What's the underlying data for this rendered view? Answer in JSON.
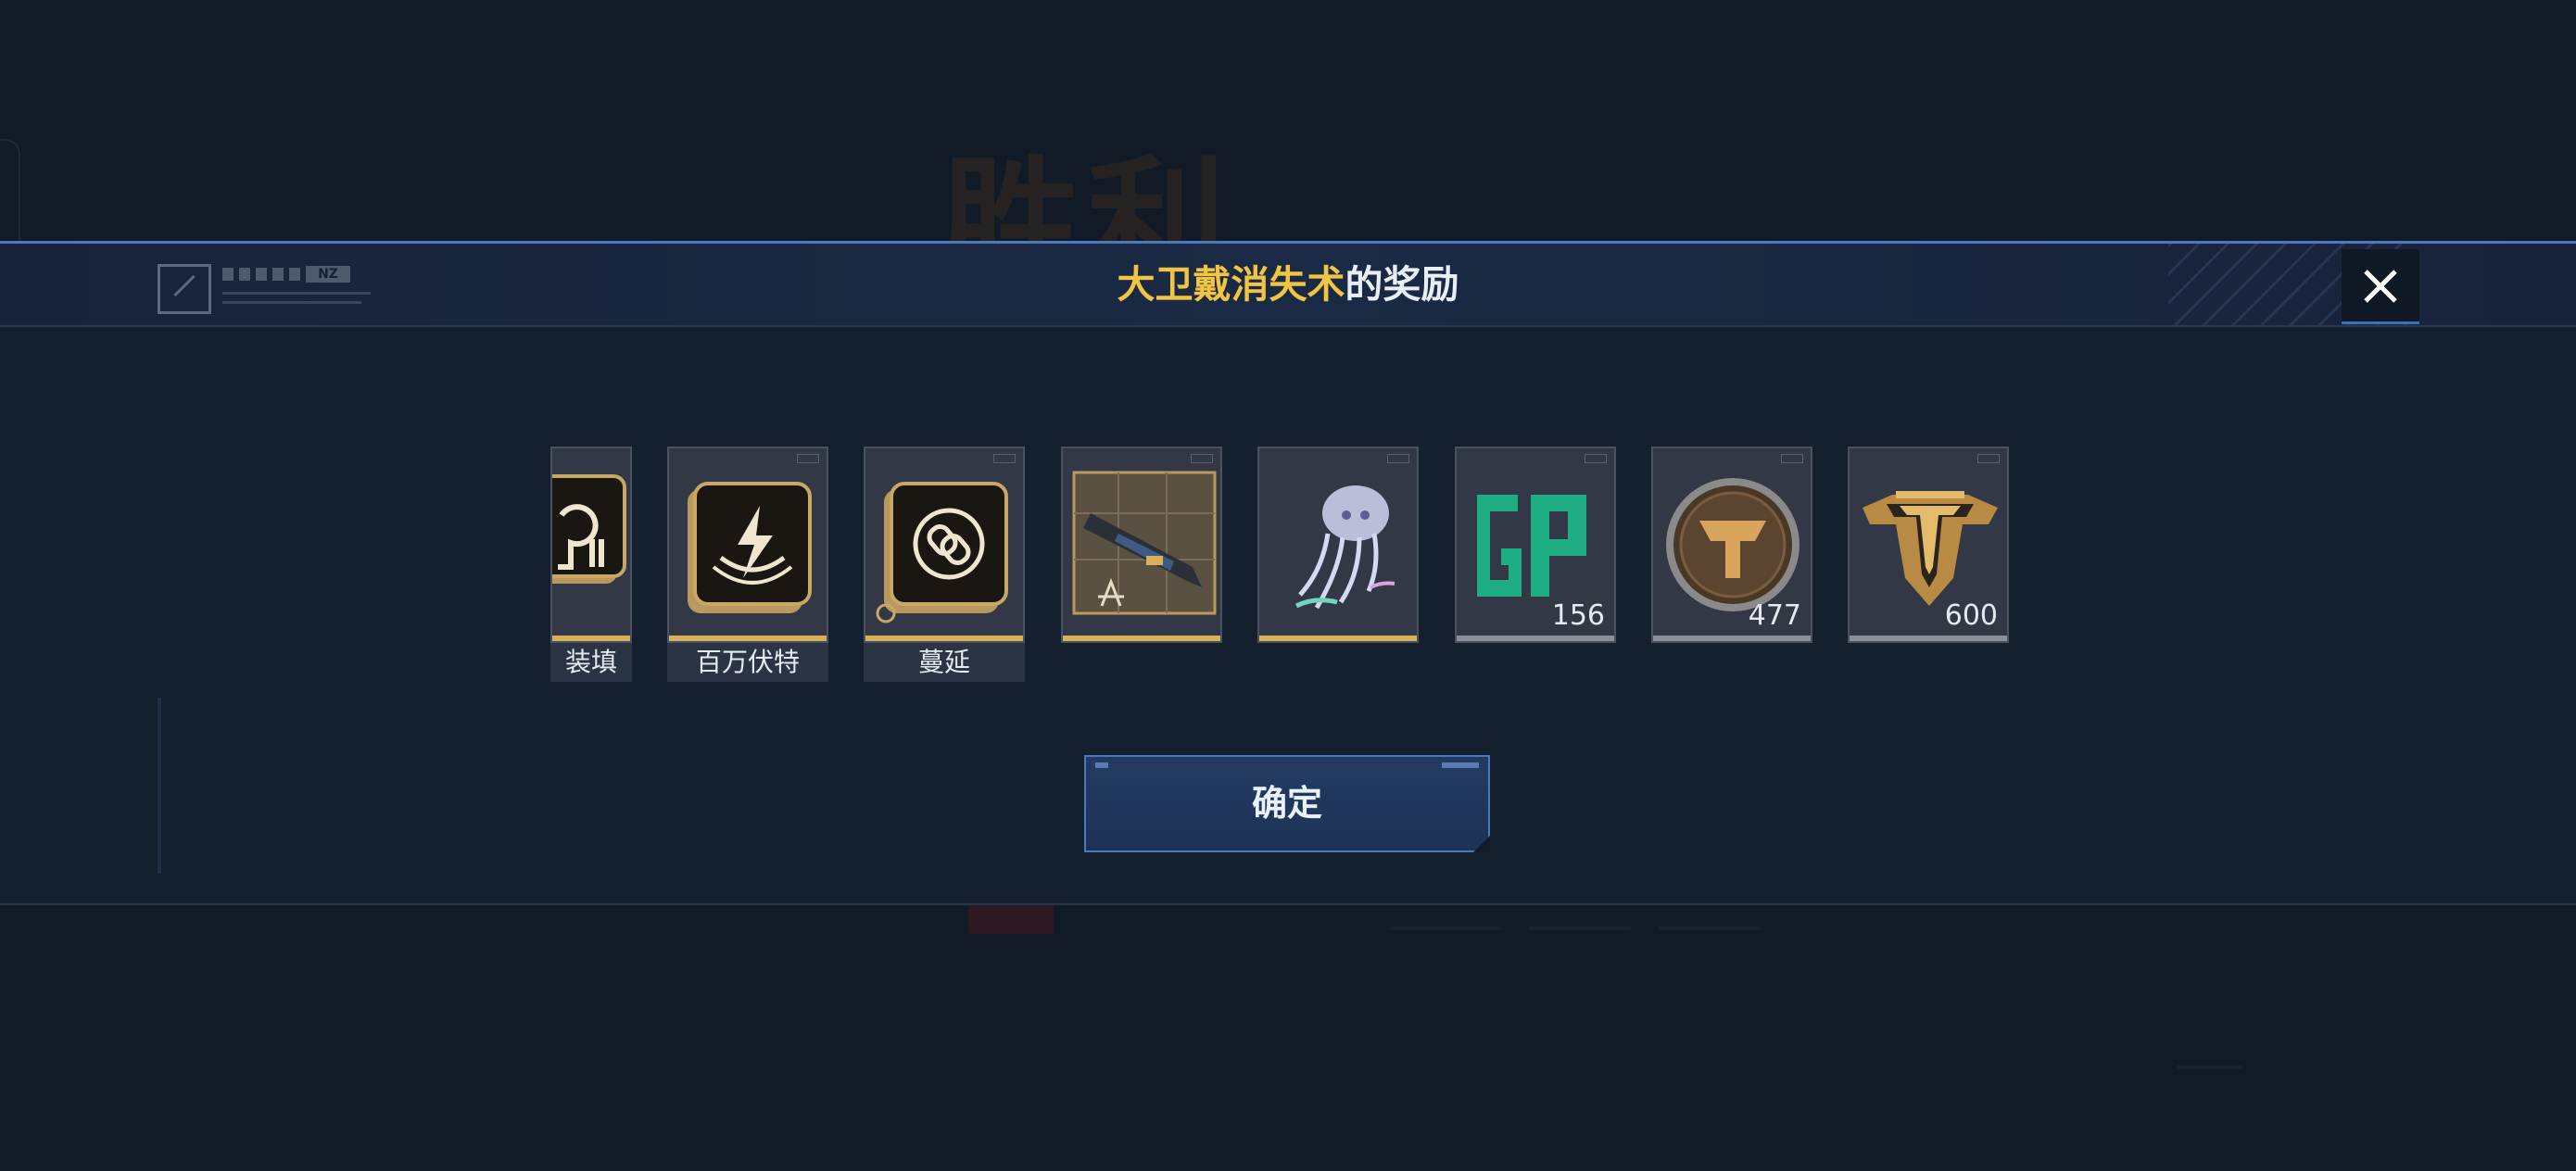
{
  "background": {
    "title": "胜利"
  },
  "dialog": {
    "title_highlight": "大卫戴消失术",
    "title_rest": "的奖励",
    "close_icon": "close-icon",
    "colors": {
      "highlight": "#f2c443",
      "accent": "#4a79c2",
      "gold_bar": "#d8b25a"
    }
  },
  "rewards": [
    {
      "icon": "reload-perk-icon",
      "label": "装填",
      "count": ""
    },
    {
      "icon": "lightning-perk-icon",
      "label": "百万伏特",
      "count": ""
    },
    {
      "icon": "chain-perk-icon",
      "label": "蔓延",
      "count": ""
    },
    {
      "icon": "weapon-blueprint-icon",
      "label": "",
      "count": ""
    },
    {
      "icon": "jellyfish-ornament-icon",
      "label": "",
      "count": ""
    },
    {
      "icon": "gp-currency-icon",
      "label": "",
      "count": "156"
    },
    {
      "icon": "bronze-badge-icon",
      "label": "",
      "count": "477"
    },
    {
      "icon": "gold-shield-badge-icon",
      "label": "",
      "count": "600"
    }
  ],
  "confirm": {
    "label": "确定"
  }
}
